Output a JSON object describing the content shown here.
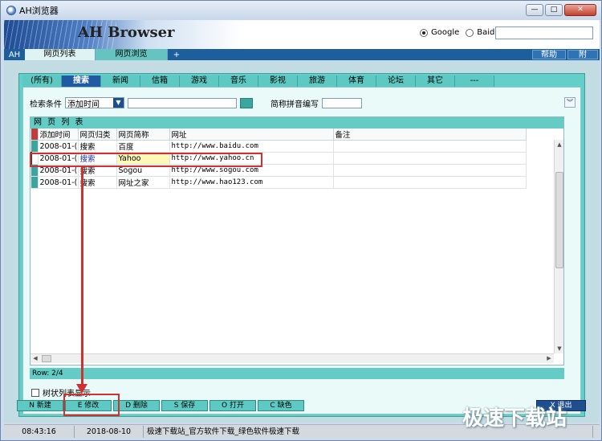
{
  "window": {
    "title": "AH浏览器",
    "controls": [
      "—",
      "□",
      "✕"
    ]
  },
  "banner": {
    "brand": "AH Browser",
    "engines": [
      {
        "label": "Google",
        "selected": true
      },
      {
        "label": "Baidu",
        "selected": false
      }
    ],
    "search_value": ""
  },
  "navbar": {
    "ah_label": "AH",
    "tabs": [
      {
        "label": "网页列表",
        "active": true
      },
      {
        "label": "网页浏览",
        "active": false
      }
    ],
    "add_tab": "+",
    "help_label": "帮助",
    "extra_label": "附"
  },
  "categories": [
    "(所有)",
    "搜索",
    "新闻",
    "信箱",
    "游戏",
    "音乐",
    "影视",
    "旅游",
    "体育",
    "论坛",
    "其它",
    "---"
  ],
  "active_category": "搜索",
  "search": {
    "condition_label": "检索条件",
    "condition_value": "添加时间",
    "query_value": "",
    "pinyin_label": "简称拼音编写",
    "pinyin_value": "",
    "collapse_icon": "double-chevron-down"
  },
  "grid": {
    "title": "网 页 列 表",
    "columns": [
      "添加时间",
      "网页归类",
      "网页简称",
      "网址",
      "备注"
    ],
    "rows": [
      {
        "date": "2008-01-(",
        "category": "搜索",
        "name": "百度",
        "url": "http://www.baidu.com",
        "note": "",
        "selected": false
      },
      {
        "date": "2008-01-(",
        "category": "搜索",
        "name": "Yahoo",
        "url": "http://www.yahoo.cn",
        "note": "",
        "selected": true
      },
      {
        "date": "2008-01-(",
        "category": "搜索",
        "name": "Sogou",
        "url": "http://www.sogou.com",
        "note": "",
        "selected": false
      },
      {
        "date": "2008-01-(",
        "category": "搜索",
        "name": "网址之家",
        "url": "http://www.hao123.com",
        "note": "",
        "selected": false
      }
    ],
    "row_info": "Row: 2/4"
  },
  "tree_toggle": {
    "label": "树状列表显示",
    "checked": false
  },
  "actions": [
    {
      "key": "N",
      "label": "新建"
    },
    {
      "key": "E",
      "label": "修改"
    },
    {
      "key": "D",
      "label": "删除"
    },
    {
      "key": "S",
      "label": "保存"
    },
    {
      "key": "O",
      "label": "打开"
    },
    {
      "key": "C",
      "label": "缺色"
    }
  ],
  "exit_label": "X 退出",
  "status": {
    "time": "08:43:16",
    "date": "2018-08-10",
    "message": "极速下载站_官方软件下载_绿色软件极速下载"
  },
  "watermark": "极速下载站",
  "colors": {
    "accent": "#64cfc8",
    "nav": "#1d5f9d",
    "highlight": "#d03030",
    "active_category": "#1f5aa3"
  }
}
